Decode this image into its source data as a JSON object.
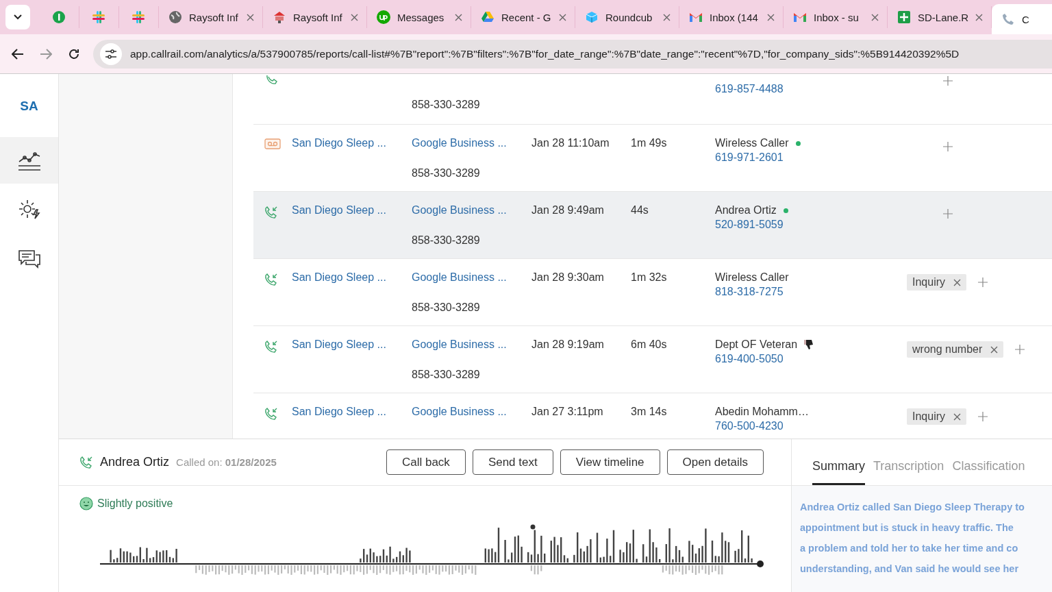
{
  "browser_tabs": [
    {
      "selected": false
    },
    {
      "selected": false
    },
    {
      "selected": false
    },
    {
      "label": "Raysoft Inf",
      "selected": false
    },
    {
      "label": "Raysoft Inf",
      "selected": false
    },
    {
      "label": "Messages",
      "selected": false
    },
    {
      "label": "Recent - G",
      "selected": false
    },
    {
      "label": "Roundcub",
      "selected": false
    },
    {
      "label": "Inbox (144",
      "selected": false
    },
    {
      "label": "Inbox - su",
      "selected": false
    },
    {
      "label": "SD-Lane.R",
      "selected": false
    },
    {
      "label": "C",
      "selected": true
    }
  ],
  "address": "app.callrail.com/analytics/a/537900785/reports/call-list#%7B\"report\":%7B\"filters\":%7B\"for_date_range\":%7B\"date_range\":\"recent\"%7D,\"for_company_sids\":%5B914420392%5D",
  "nav": {
    "account": "SA",
    "items": [
      {
        "selected": true
      },
      {
        "selected": false
      },
      {
        "selected": false
      }
    ]
  },
  "calls": [
    {
      "kind": "answered",
      "selected": false,
      "tracking_number": "858-330-3289",
      "caller_phone": "619-857-4488"
    },
    {
      "kind": "voicemail",
      "selected": false,
      "company": "San Diego Sleep ...",
      "source": "Google Business ...",
      "tracking_number": "858-330-3289",
      "date": "Jan 28 11:10am",
      "duration": "1m 49s",
      "caller": "Wireless Caller",
      "dot": true,
      "caller_phone": "619-971-2601"
    },
    {
      "kind": "inbound",
      "selected": true,
      "company": "San Diego Sleep ...",
      "source": "Google Business ...",
      "tracking_number": "858-330-3289",
      "date": "Jan 28 9:49am",
      "duration": "44s",
      "caller": "Andrea Ortiz",
      "dot": true,
      "caller_phone": "520-891-5059"
    },
    {
      "kind": "inbound",
      "selected": false,
      "company": "San Diego Sleep ...",
      "source": "Google Business ...",
      "tracking_number": "858-330-3289",
      "date": "Jan 28 9:30am",
      "duration": "1m 32s",
      "caller": "Wireless Caller",
      "dot": false,
      "caller_phone": "818-318-7275",
      "tags": [
        "Inquiry"
      ]
    },
    {
      "kind": "inbound",
      "selected": false,
      "company": "San Diego Sleep ...",
      "source": "Google Business ...",
      "tracking_number": "858-330-3289",
      "date": "Jan 28 9:19am",
      "duration": "6m 40s",
      "caller": "Dept OF Veteran",
      "thumbs_down": true,
      "caller_phone": "619-400-5050",
      "tags": [
        "wrong number"
      ]
    },
    {
      "kind": "inbound",
      "selected": false,
      "company": "San Diego Sleep ...",
      "source": "Google Business ...",
      "date": "Jan 27 3:11pm",
      "duration": "3m 14s",
      "caller": "Abedin Mohamm…",
      "dot": false,
      "caller_phone": "760-500-4230",
      "tags": [
        "Inquiry"
      ]
    }
  ],
  "detail": {
    "caller": "Andrea Ortiz",
    "called_on_label": "Called on:",
    "called_on": "01/28/2025",
    "buttons": [
      "Call back",
      "Send text",
      "View timeline",
      "Open details"
    ],
    "sentiment": "Slightly positive"
  },
  "summary_tabs": [
    {
      "label": "Summary",
      "selected": true
    },
    {
      "label": "Transcription",
      "selected": false
    },
    {
      "label": "Classification",
      "selected": false
    }
  ],
  "summary_lines": [
    "Andrea Ortiz called San Diego Sleep Therapy to",
    "appointment but is stuck in heavy traffic. The",
    "a problem and told her to take her time and co",
    "understanding, and Van said he would see her"
  ]
}
